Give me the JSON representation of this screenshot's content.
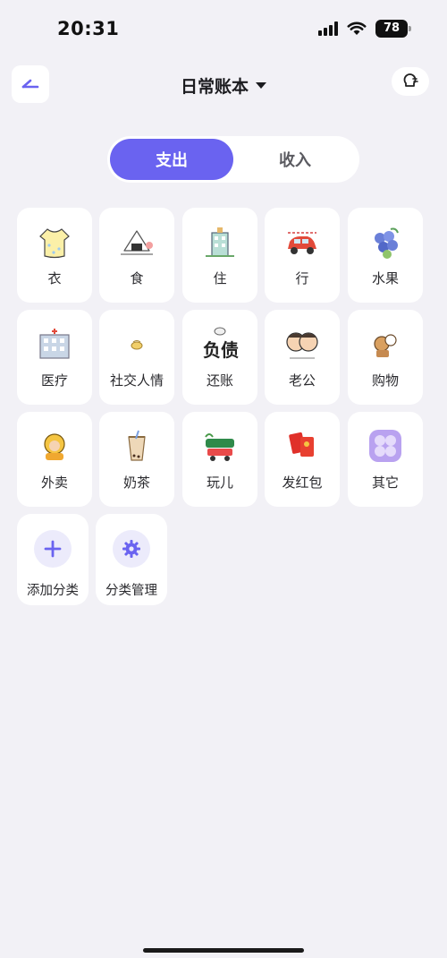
{
  "status_bar": {
    "time": "20:31",
    "battery": "78"
  },
  "header": {
    "title": "日常账本"
  },
  "tabs": [
    {
      "label": "支出",
      "active": true
    },
    {
      "label": "收入",
      "active": false
    }
  ],
  "categories": [
    {
      "label": "衣",
      "icon": "dress-icon"
    },
    {
      "label": "食",
      "icon": "rice-ball-icon"
    },
    {
      "label": "住",
      "icon": "building-icon"
    },
    {
      "label": "行",
      "icon": "car-icon"
    },
    {
      "label": "水果",
      "icon": "grapes-icon"
    },
    {
      "label": "医疗",
      "icon": "hospital-icon"
    },
    {
      "label": "社交人情",
      "icon": "gift-icon"
    },
    {
      "label": "还账",
      "icon": "debt-icon"
    },
    {
      "label": "老公",
      "icon": "couple-icon"
    },
    {
      "label": "购物",
      "icon": "shopping-icon"
    },
    {
      "label": "外卖",
      "icon": "delivery-icon"
    },
    {
      "label": "奶茶",
      "icon": "milk-tea-icon"
    },
    {
      "label": "玩儿",
      "icon": "vacation-icon"
    },
    {
      "label": "发红包",
      "icon": "red-envelope-icon"
    },
    {
      "label": "其它",
      "icon": "other-icon"
    }
  ],
  "actions": [
    {
      "label": "添加分类",
      "icon": "plus-icon"
    },
    {
      "label": "分类管理",
      "icon": "gear-icon"
    }
  ],
  "colors": {
    "accent": "#6a63f0",
    "background": "#f2f1f6"
  }
}
